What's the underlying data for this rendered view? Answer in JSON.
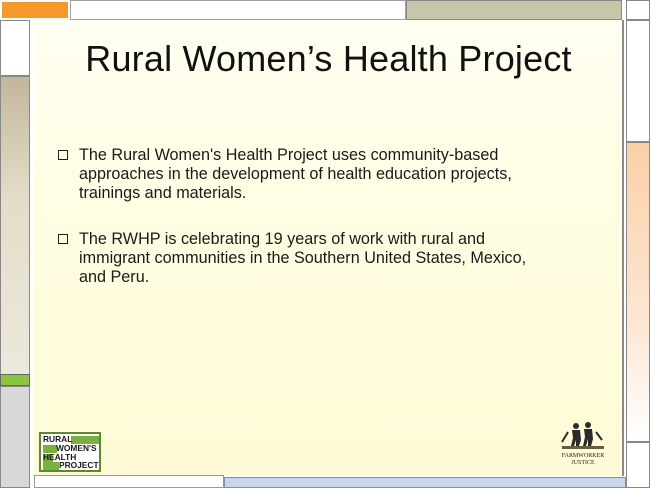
{
  "slide": {
    "title": "Rural Women’s Health Project",
    "bullets": [
      "The Rural Women's Health Project uses community-based approaches in the development of health education projects, trainings and materials.",
      "The RWHP is celebrating 19 years of work with rural and immigrant communities in the Southern United States, Mexico, and Peru."
    ]
  },
  "logos": {
    "rwhp": [
      "RURAL",
      "WOMEN'S",
      "HEALTH",
      "PROJECT"
    ],
    "fj": [
      "FARMWORKER",
      "JUSTICE"
    ]
  },
  "colors": {
    "accent_orange": "#f59a2a",
    "accent_green": "#8cc63f",
    "tan": "#c8c0a8",
    "gray": "#d0d0d0"
  }
}
